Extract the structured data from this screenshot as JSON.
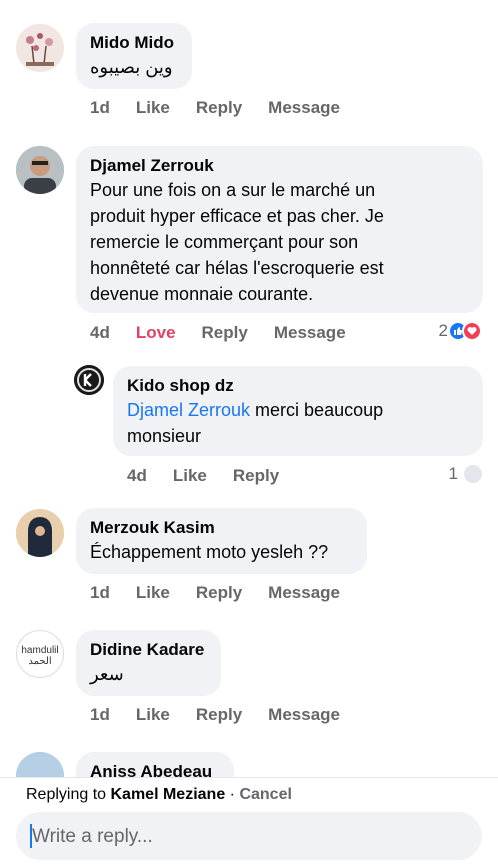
{
  "comments": [
    {
      "name": "Mido Mido",
      "text": "وين بصيبوه",
      "time": "1d",
      "actions": [
        "Like",
        "Reply",
        "Message"
      ]
    },
    {
      "name": "Djamel Zerrouk",
      "text_lines": [
        "Pour une fois on a sur le marché un",
        "produit hyper efficace et pas cher. Je",
        "remercie le commerçant pour son",
        "honnêteté car hélas l'escroquerie est",
        "devenue monnaie courante."
      ],
      "time": "4d",
      "actions": [
        "Love",
        "Reply",
        "Message"
      ],
      "reaction_count": "2"
    },
    {
      "name": "Kido shop dz",
      "mention": "Djamel Zerrouk",
      "text_line1": "merci beaucoup",
      "text_line2": "monsieur",
      "time": "4d",
      "actions": [
        "Like",
        "Reply"
      ],
      "reaction_count": "1"
    },
    {
      "name": "Merzouk Kasim",
      "text": "Échappement moto yesleh ??",
      "time": "1d",
      "actions": [
        "Like",
        "Reply",
        "Message"
      ]
    },
    {
      "name": "Didine Kadare",
      "text": "سعر",
      "time": "1d",
      "actions": [
        "Like",
        "Reply",
        "Message"
      ],
      "avatar_lines": [
        "hamdulil",
        "الحمد"
      ]
    },
    {
      "name": "Aniss Abedeau"
    }
  ],
  "footer": {
    "replying_prefix": "Replying to",
    "replying_name": "Kamel Meziane",
    "separator": " · ",
    "cancel": "Cancel",
    "placeholder": "Write a reply..."
  },
  "colors": {
    "bubble": "#f0f2f5",
    "meta": "#65676b",
    "love": "#e4405f",
    "mention": "#1877f2"
  }
}
